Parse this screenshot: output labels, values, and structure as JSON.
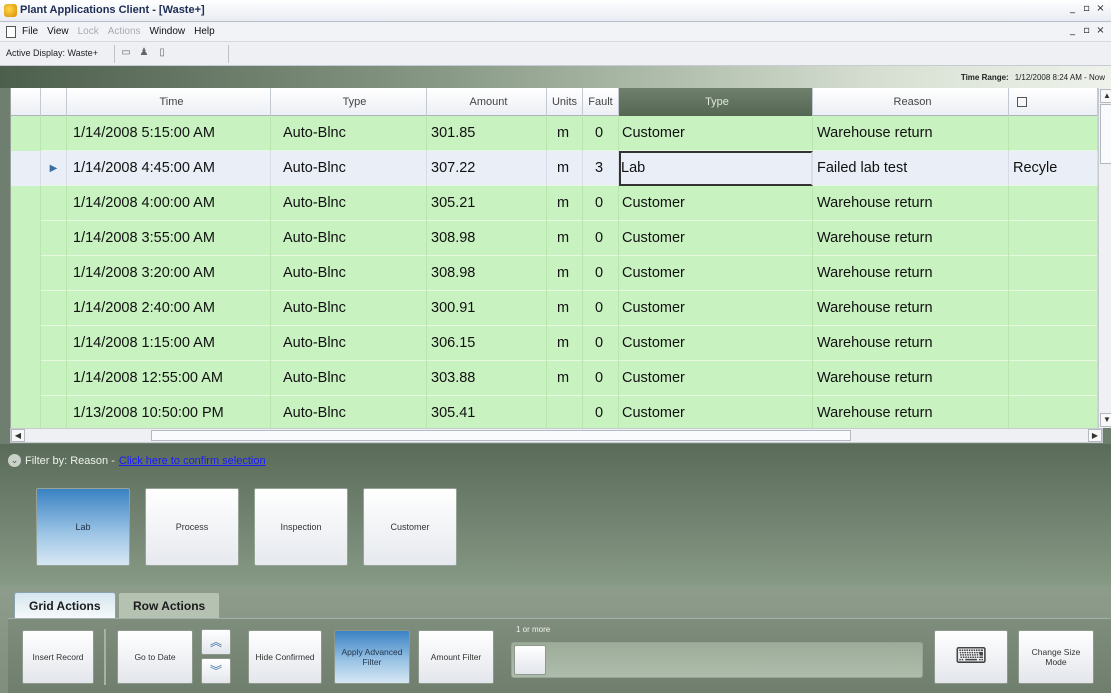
{
  "window": {
    "title": "Plant Applications Client - [Waste+]",
    "controls": [
      "_",
      "▫",
      "×"
    ],
    "mdi_controls": [
      "_",
      "▫",
      "×"
    ]
  },
  "menu": [
    "File",
    "View",
    "Lock",
    "Actions",
    "Window",
    "Help"
  ],
  "toolbar": {
    "active_display": "Active Display: Waste+"
  },
  "time_range": {
    "label": "Time Range:",
    "value": "1/12/2008 8:24 AM - Now"
  },
  "grid": {
    "columns": [
      "Time",
      "Type",
      "Amount",
      "Units",
      "Fault",
      "Type",
      "Reason",
      ""
    ],
    "active_column_index": 5,
    "rows": [
      {
        "time": "1/14/2008 5:15:00 AM",
        "type": "Auto-Blnc",
        "amount": "301.85",
        "units": "m",
        "fault": "0",
        "type2": "Customer",
        "reason": "Warehouse return",
        "extra": ""
      },
      {
        "time": "1/14/2008 4:45:00 AM",
        "type": "Auto-Blnc",
        "amount": "307.22",
        "units": "m",
        "fault": "3",
        "type2": "Lab",
        "reason": "Failed lab test",
        "extra": "Recyle"
      },
      {
        "time": "1/14/2008 4:00:00 AM",
        "type": "Auto-Blnc",
        "amount": "305.21",
        "units": "m",
        "fault": "0",
        "type2": "Customer",
        "reason": "Warehouse return",
        "extra": ""
      },
      {
        "time": "1/14/2008 3:55:00 AM",
        "type": "Auto-Blnc",
        "amount": "308.98",
        "units": "m",
        "fault": "0",
        "type2": "Customer",
        "reason": "Warehouse return",
        "extra": ""
      },
      {
        "time": "1/14/2008 3:20:00 AM",
        "type": "Auto-Blnc",
        "amount": "308.98",
        "units": "m",
        "fault": "0",
        "type2": "Customer",
        "reason": "Warehouse return",
        "extra": ""
      },
      {
        "time": "1/14/2008 2:40:00 AM",
        "type": "Auto-Blnc",
        "amount": "300.91",
        "units": "m",
        "fault": "0",
        "type2": "Customer",
        "reason": "Warehouse return",
        "extra": ""
      },
      {
        "time": "1/14/2008 1:15:00 AM",
        "type": "Auto-Blnc",
        "amount": "306.15",
        "units": "m",
        "fault": "0",
        "type2": "Customer",
        "reason": "Warehouse return",
        "extra": ""
      },
      {
        "time": "1/14/2008 12:55:00 AM",
        "type": "Auto-Blnc",
        "amount": "303.88",
        "units": "m",
        "fault": "0",
        "type2": "Customer",
        "reason": "Warehouse return",
        "extra": ""
      },
      {
        "time": "1/13/2008 10:50:00 PM",
        "type": "Auto-Blnc",
        "amount": "305.41",
        "units": "",
        "fault": "0",
        "type2": "Customer",
        "reason": "Warehouse return",
        "extra": ""
      }
    ],
    "selected_row_index": 1,
    "row_pointer": "▶"
  },
  "filter": {
    "label": "Filter by: Reason -",
    "link": "Click here to confirm selection",
    "options": [
      "Lab",
      "Process",
      "Inspection",
      "Customer"
    ],
    "active_option": "Lab"
  },
  "tabs": [
    "Grid Actions",
    "Row Actions"
  ],
  "actions": {
    "insert_record": "Insert Record",
    "go_to_date": "Go to Date",
    "up": "︽",
    "down": "︾",
    "hide_confirmed": "Hide Confirmed",
    "apply_advanced_filter": "Apply Advanced Filter",
    "amount_filter": "Amount Filter",
    "slider_label": "1 or more",
    "keyboard_icon": "⌨",
    "change_size_mode": "Change Size Mode"
  }
}
